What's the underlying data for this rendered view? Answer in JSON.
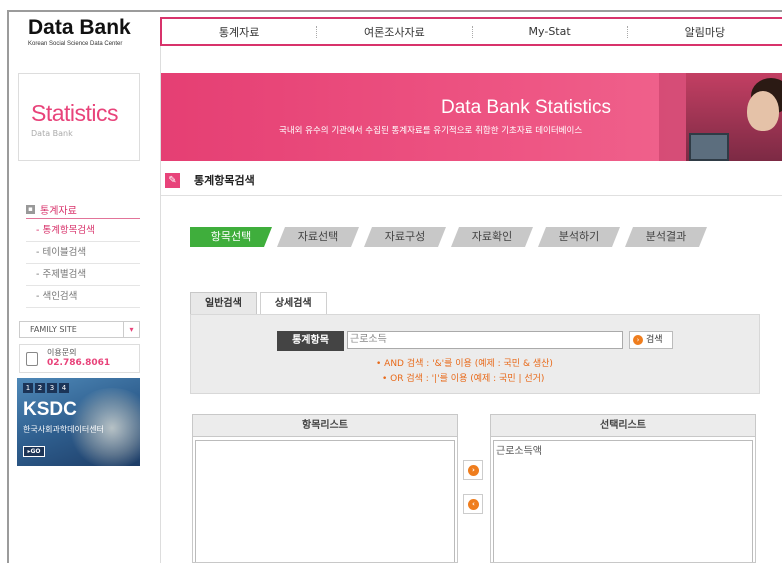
{
  "logo": {
    "title": "Data Bank",
    "subtitle": "Korean Social Science Data Center"
  },
  "gnb": {
    "items": [
      "통계자료",
      "여론조사자료",
      "My-Stat",
      "알림마당"
    ]
  },
  "side": {
    "stat_title": "Statistics",
    "stat_sub": "Data Bank",
    "lnb_title": "통계자료",
    "lnb_items": [
      "- 통계항목검색",
      "- 테이블검색",
      "- 주제별검색",
      "- 색인검색"
    ],
    "family_site": "FAMILY SITE",
    "family_arrow": "▾",
    "contact_label": "이용문의",
    "contact_phone": "02.786.8061"
  },
  "ksdc": {
    "nums": [
      "1",
      "2",
      "3",
      "4"
    ],
    "title": "KSDC",
    "subtitle": "한국사회과학데이터센터",
    "go": "▸GO"
  },
  "banner": {
    "title": "Data Bank Statistics",
    "subtitle": "국내외 유수의 기관에서 수집된 통계자료를 유기적으로 취합한 기초자료 데이터베이스"
  },
  "section": {
    "title": "통계항목검색"
  },
  "steps": [
    "항목선택",
    "자료선택",
    "자료구성",
    "자료확인",
    "분석하기",
    "분석결과"
  ],
  "tabs": [
    "일반검색",
    "상세검색"
  ],
  "search": {
    "label": "통계항목",
    "value": "근로소득",
    "button": "검색",
    "hint_and": "• AND 검색 : '&'를 이용 (예제 : 국민 & 생산)",
    "hint_or": "• OR 검색 : '|'를 이용 (예제 : 국민 | 선거)"
  },
  "lists": {
    "left_header": "항목리스트",
    "right_header": "선택리스트",
    "right_items": [
      "근로소득액"
    ]
  },
  "colors": {
    "accent": "#d8336b",
    "step_active": "#3fae3c",
    "orange": "#ef7d1d"
  }
}
